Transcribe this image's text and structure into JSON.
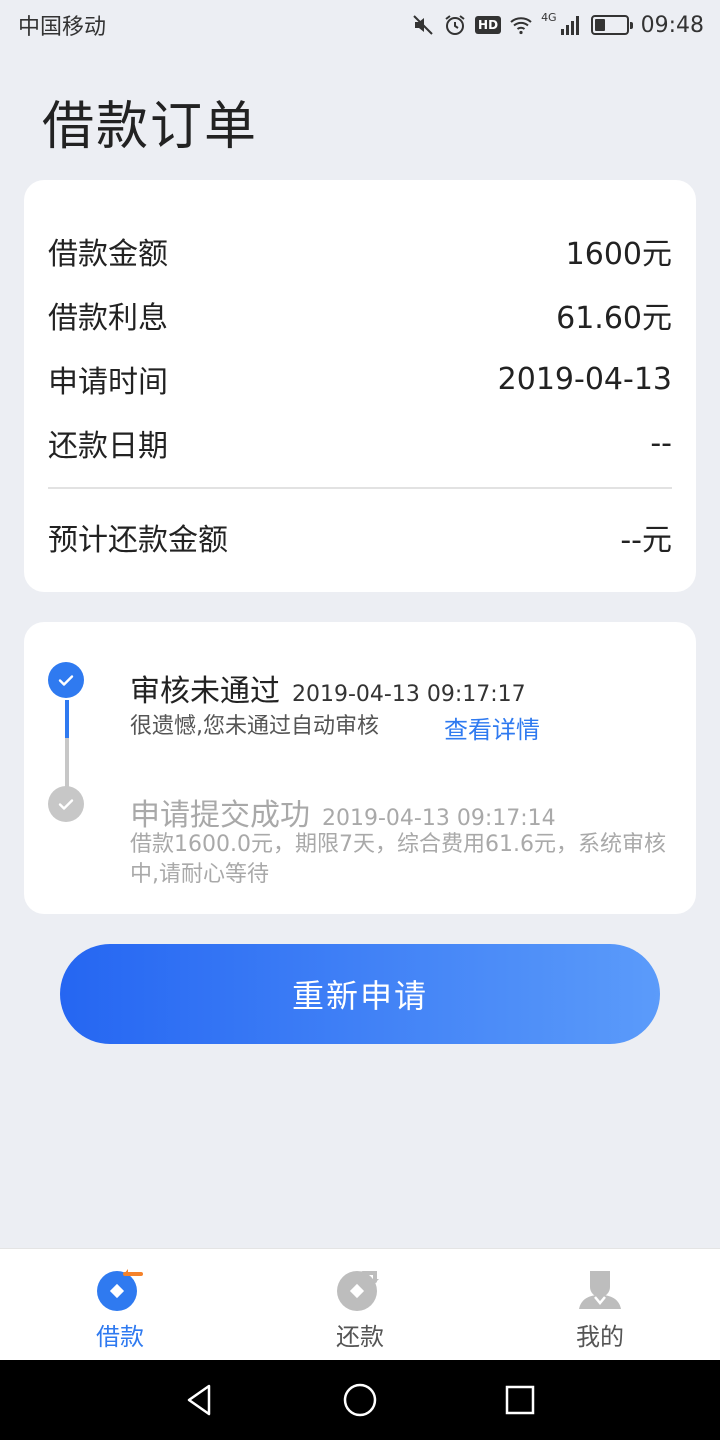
{
  "status_bar": {
    "carrier": "中国移动",
    "network": "4G",
    "hd_badge": "HD",
    "time": "09:48",
    "icons": [
      "mute-icon",
      "alarm-icon",
      "hd-icon",
      "wifi-icon",
      "signal-icon",
      "battery-icon"
    ]
  },
  "page": {
    "title": "借款订单"
  },
  "loan_info": {
    "rows": [
      {
        "label": "借款金额",
        "value": "1600元"
      },
      {
        "label": "借款利息",
        "value": "61.60元"
      },
      {
        "label": "申请时间",
        "value": "2019-04-13"
      },
      {
        "label": "还款日期",
        "value": "--"
      }
    ],
    "total": {
      "label": "预计还款金额",
      "value": "--元"
    }
  },
  "timeline": {
    "items": [
      {
        "title": "审核未通过",
        "time": "2019-04-13 09:17:17",
        "desc": "很遗憾,您未通过自动审核",
        "link": "查看详情",
        "state": "active"
      },
      {
        "title": "申请提交成功",
        "time": "2019-04-13 09:17:14",
        "desc_line1": "借款1600.0元，期限7天，综合费用61.6元，系统审核",
        "desc_line2": "中,请耐心等待",
        "state": "done"
      }
    ]
  },
  "actions": {
    "reapply_label": "重新申请"
  },
  "tabs": [
    {
      "label": "借款",
      "icon": "loan-icon",
      "active": true
    },
    {
      "label": "还款",
      "icon": "repay-icon",
      "active": false
    },
    {
      "label": "我的",
      "icon": "profile-icon",
      "active": false
    }
  ],
  "colors": {
    "accent": "#2f7af0",
    "background": "#eceef3",
    "button_gradient_start": "#2566f2",
    "button_gradient_end": "#5b9bfa",
    "tab_badge_orange": "#f5822a"
  }
}
